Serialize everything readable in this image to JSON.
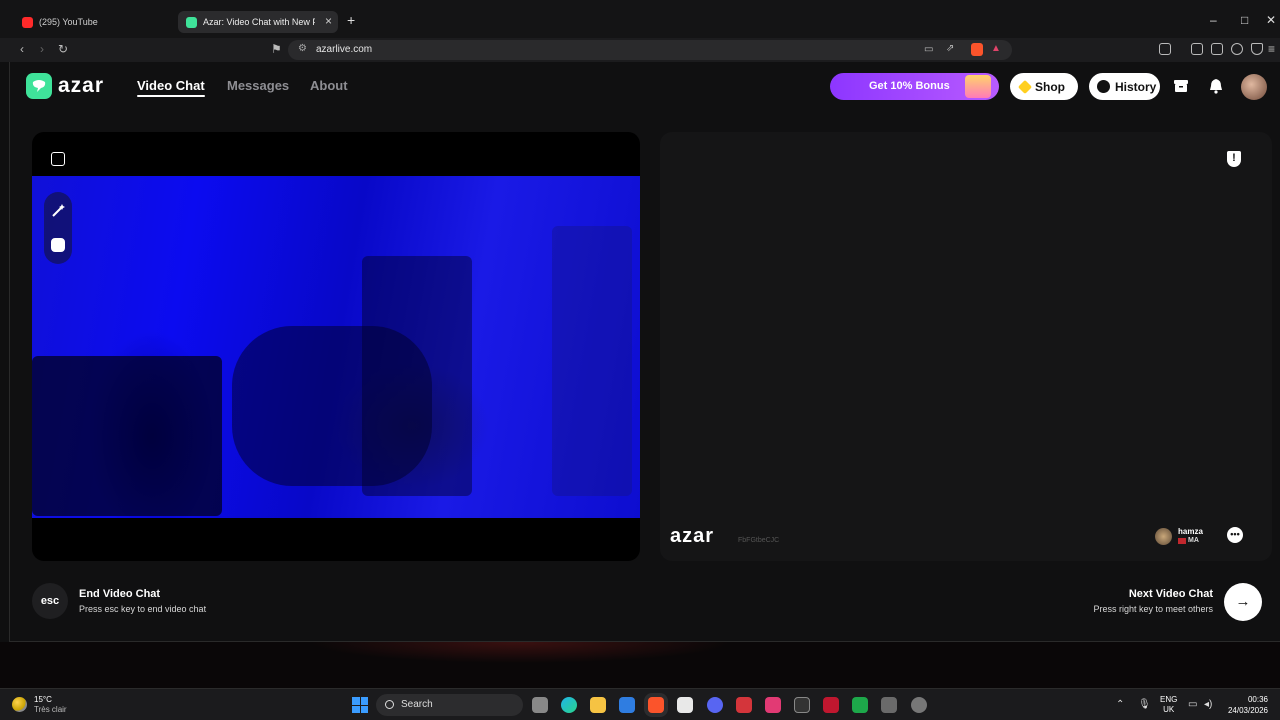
{
  "browser": {
    "tabs": [
      {
        "title": "(295) YouTube",
        "active": false
      },
      {
        "title": "Azar: Video Chat with New Pe",
        "active": true
      }
    ],
    "url": "azarlive.com",
    "window_controls": {
      "minimize": "–",
      "maximize": "□",
      "close": "✕"
    }
  },
  "app": {
    "logo_text": "azar",
    "nav": [
      {
        "label": "Video Chat",
        "active": true
      },
      {
        "label": "Messages",
        "active": false
      },
      {
        "label": "About",
        "active": false
      }
    ],
    "bonus_label": "Get 10% Bonus",
    "shop_label": "Shop",
    "history_label": "History",
    "icons": [
      "inbox-icon",
      "bell-icon",
      "avatar"
    ]
  },
  "peer": {
    "watermark": "azar",
    "id_text": "FbFGtbeCJC",
    "name": "hamza",
    "country": "MA"
  },
  "controls": {
    "end_key": "esc",
    "end_title": "End Video Chat",
    "end_subtitle": "Press esc key to end video chat",
    "next_title": "Next Video Chat",
    "next_subtitle": "Press right key to meet others"
  },
  "taskbar": {
    "temperature": "15°C",
    "condition": "Très clair",
    "search_placeholder": "Search",
    "lang_top": "ENG",
    "lang_bottom": "UK",
    "time": "00:36",
    "date": "24/03/2026"
  },
  "colors": {
    "accent_green": "#3fe39a",
    "bonus_purple": "#8d36ff",
    "self_video_blue": "#0b0bf0"
  }
}
